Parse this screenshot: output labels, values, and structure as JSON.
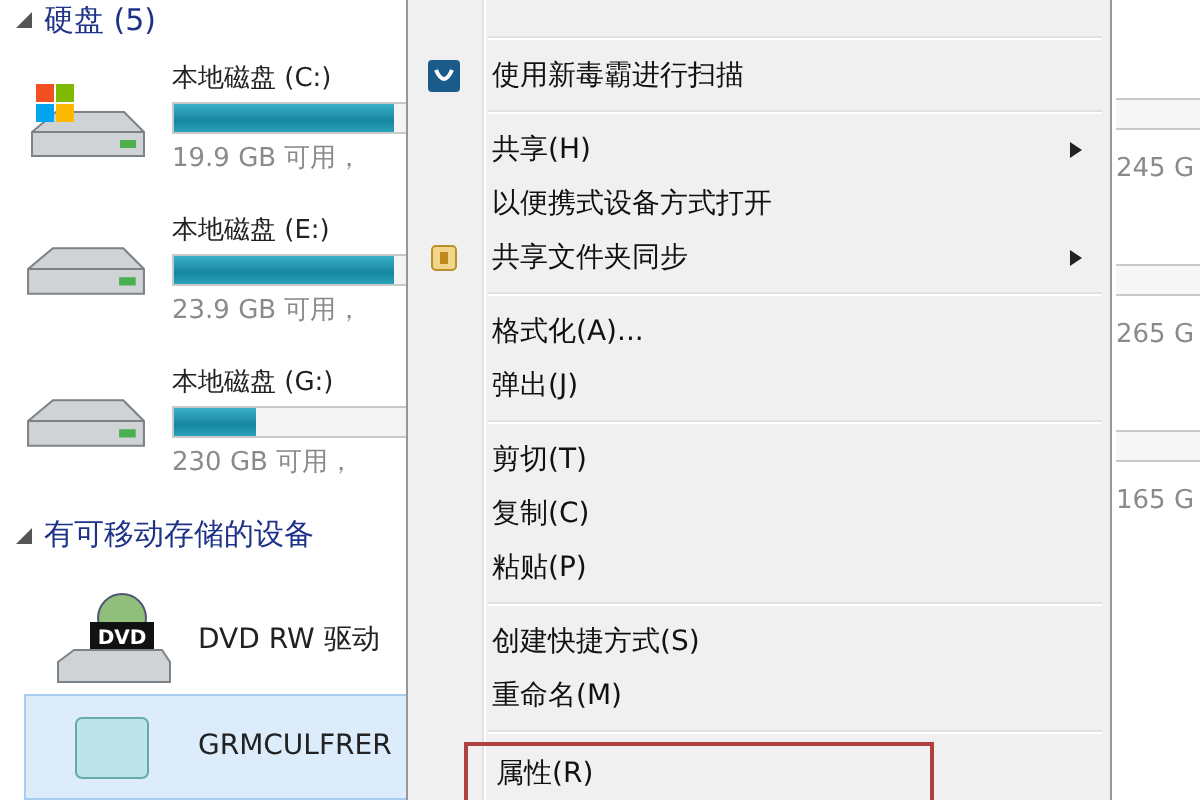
{
  "explorer": {
    "hard_disk_group": {
      "title": "硬盘 (5)",
      "drives": [
        {
          "kind": "system",
          "name": "本地磁盘 (C:)",
          "level": 0.95,
          "free": "19.9 GB 可用，"
        },
        {
          "kind": "disk",
          "name": "本地磁盘 (E:)",
          "level": 0.95,
          "free": "23.9 GB 可用，"
        },
        {
          "kind": "disk",
          "name": "本地磁盘 (G:)",
          "level": 0.35,
          "free": "230 GB 可用，"
        }
      ],
      "right_column": [
        {
          "free": "245 G"
        },
        {
          "free": "265 G"
        },
        {
          "free": "165 G"
        }
      ]
    },
    "removable_group": {
      "title": "有可移动存储的设备",
      "devices": [
        {
          "kind": "dvd",
          "name": "DVD RW 驱动",
          "icon_label": "DVD",
          "selected": false
        },
        {
          "kind": "portable",
          "name": "GRMCULFRER",
          "selected": true
        }
      ]
    }
  },
  "context_menu": {
    "groups": [
      [
        {
          "label": "使用新毒霸进行扫描",
          "kind": "scan",
          "submenu": false,
          "outlined": false
        }
      ],
      [
        {
          "label": "共享(H)",
          "submenu": true,
          "outlined": false
        },
        {
          "label": "以便携式设备方式打开",
          "submenu": false,
          "outlined": false
        },
        {
          "label": "共享文件夹同步",
          "kind": "sync",
          "submenu": true,
          "outlined": false
        }
      ],
      [
        {
          "label": "格式化(A)...",
          "submenu": false,
          "outlined": false
        },
        {
          "label": "弹出(J)",
          "submenu": false,
          "outlined": false
        }
      ],
      [
        {
          "label": "剪切(T)",
          "submenu": false,
          "outlined": false
        },
        {
          "label": "复制(C)",
          "submenu": false,
          "outlined": false
        },
        {
          "label": "粘贴(P)",
          "submenu": false,
          "outlined": false
        }
      ],
      [
        {
          "label": "创建快捷方式(S)",
          "submenu": false,
          "outlined": false
        },
        {
          "label": "重命名(M)",
          "submenu": false,
          "outlined": false
        }
      ],
      [
        {
          "label": "属性(R)",
          "submenu": false,
          "outlined": true
        }
      ]
    ]
  }
}
